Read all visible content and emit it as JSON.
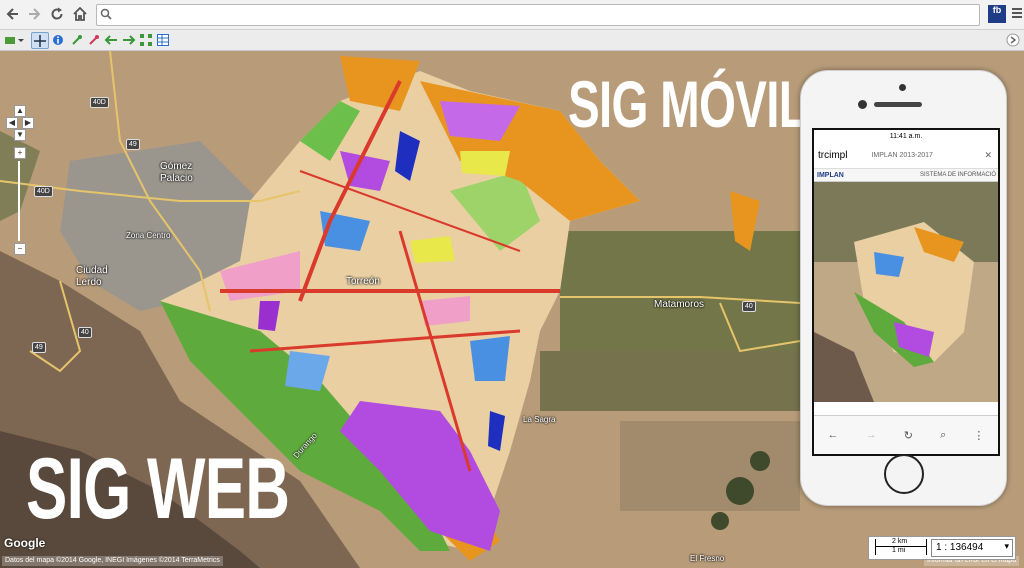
{
  "browser": {
    "url_value": "",
    "ext_icon": "fb",
    "back_icon": "back-arrow-icon",
    "forward_icon": "forward-arrow-icon",
    "reload_icon": "reload-icon",
    "home_icon": "home-icon",
    "search_icon": "magnifier-icon",
    "menu_icon": "hamburger-menu-icon"
  },
  "map": {
    "labels": {
      "gomez": "Gómez\nPalacio",
      "zona_centro": "Zona Centro",
      "ciudad_lerdo": "Ciudad\nLerdo",
      "torreon": "Torreón",
      "matamoros": "Matamoros",
      "la_sagra": "La Sagra",
      "durango": "Durango",
      "el_fresno": "El Fresno"
    },
    "shields": [
      "40D",
      "49",
      "40D",
      "40",
      "49",
      "40"
    ],
    "headline_web": "SIG WEB",
    "headline_movil": "SIG MÓVIL",
    "google": "Google",
    "attribution": "Datos del mapa ©2014 Google, INEGI Imágenes ©2014 TerraMetrics",
    "report_error": "Informar un error en el mapa",
    "scale_km": "2 km",
    "scale_mi": "1 mi",
    "scale_ratio": "1 : 136494"
  },
  "phone": {
    "status_time": "11:41 a.m.",
    "site_short": "trcimpl",
    "site_title": "IMPLAN 2013-2017",
    "header_logo": "IMPLAN",
    "header_text": "SISTEMA DE INFORMACIÓ"
  },
  "colors": {
    "accent": "#1f3d87",
    "zone_orange": "#e8951f",
    "zone_purple": "#b24be0",
    "zone_green": "#5faa3c",
    "zone_blue": "#4a90e2",
    "road_red": "#d93a2b"
  }
}
